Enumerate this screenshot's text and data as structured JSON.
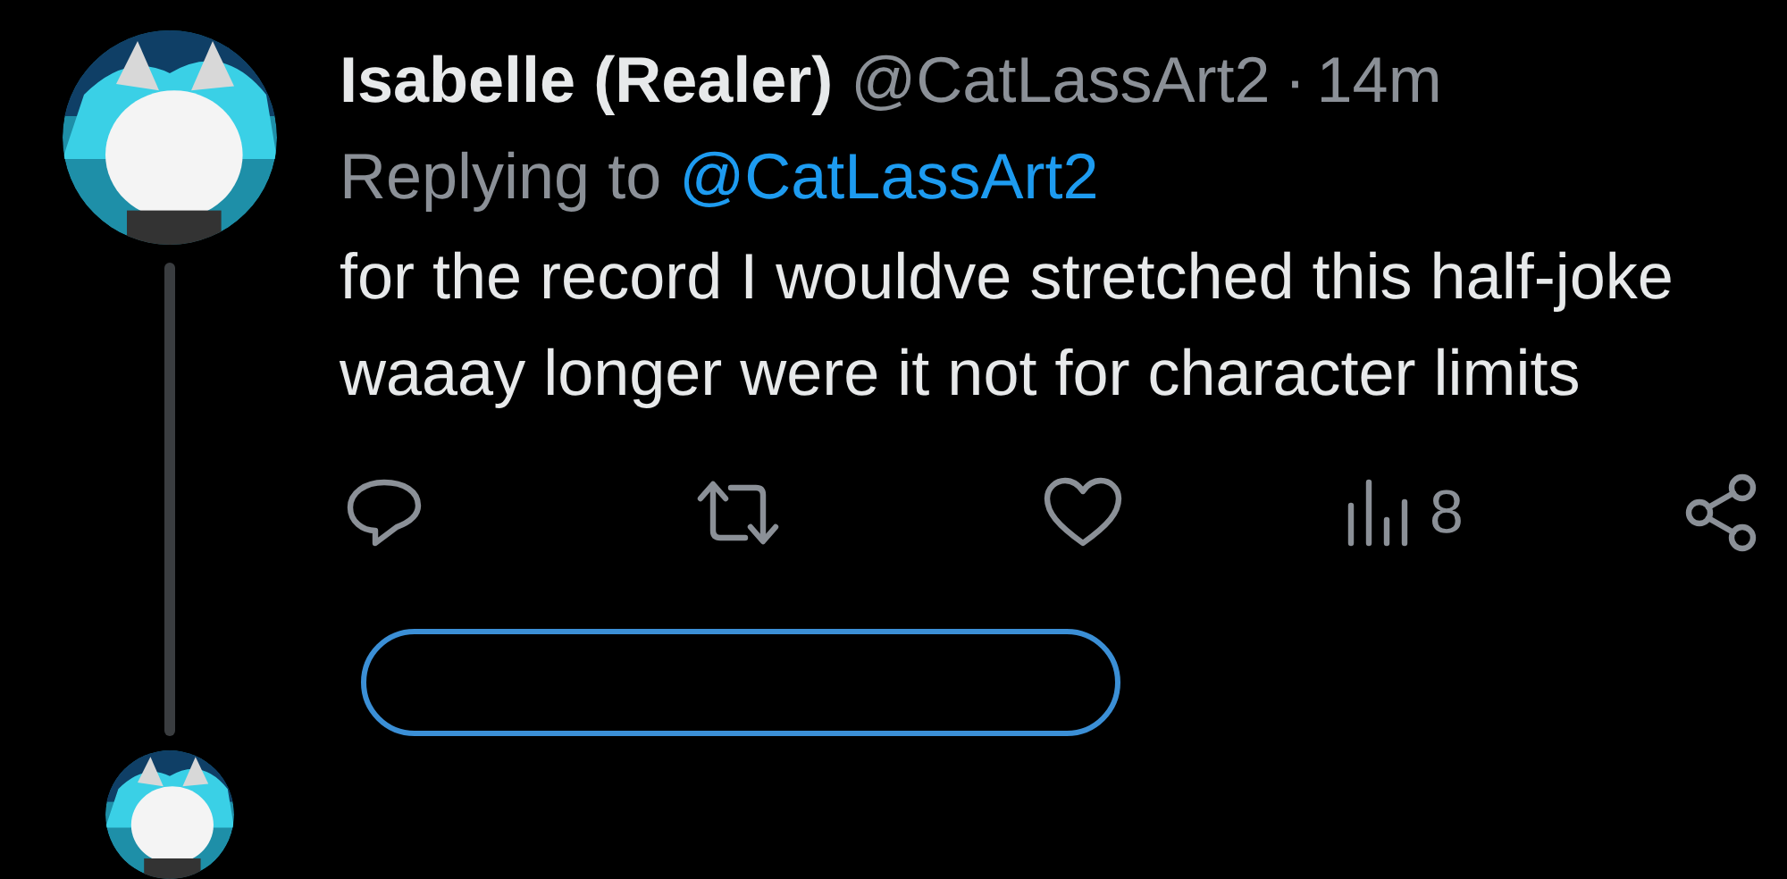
{
  "tweet": {
    "author": {
      "display_name": "Isabelle (Realer)",
      "handle": "@CatLassArt2",
      "separator": "·",
      "time": "14m"
    },
    "reply_to": {
      "prefix": "Replying to",
      "handle": "@CatLassArt2"
    },
    "text": "for the record I wouldve stretched this half-joke waaay longer were it not for character limits",
    "actions": [
      {
        "kind": "reply"
      },
      {
        "kind": "retweet"
      },
      {
        "kind": "like"
      },
      {
        "kind": "views",
        "count": "8"
      },
      {
        "kind": "share"
      }
    ]
  }
}
